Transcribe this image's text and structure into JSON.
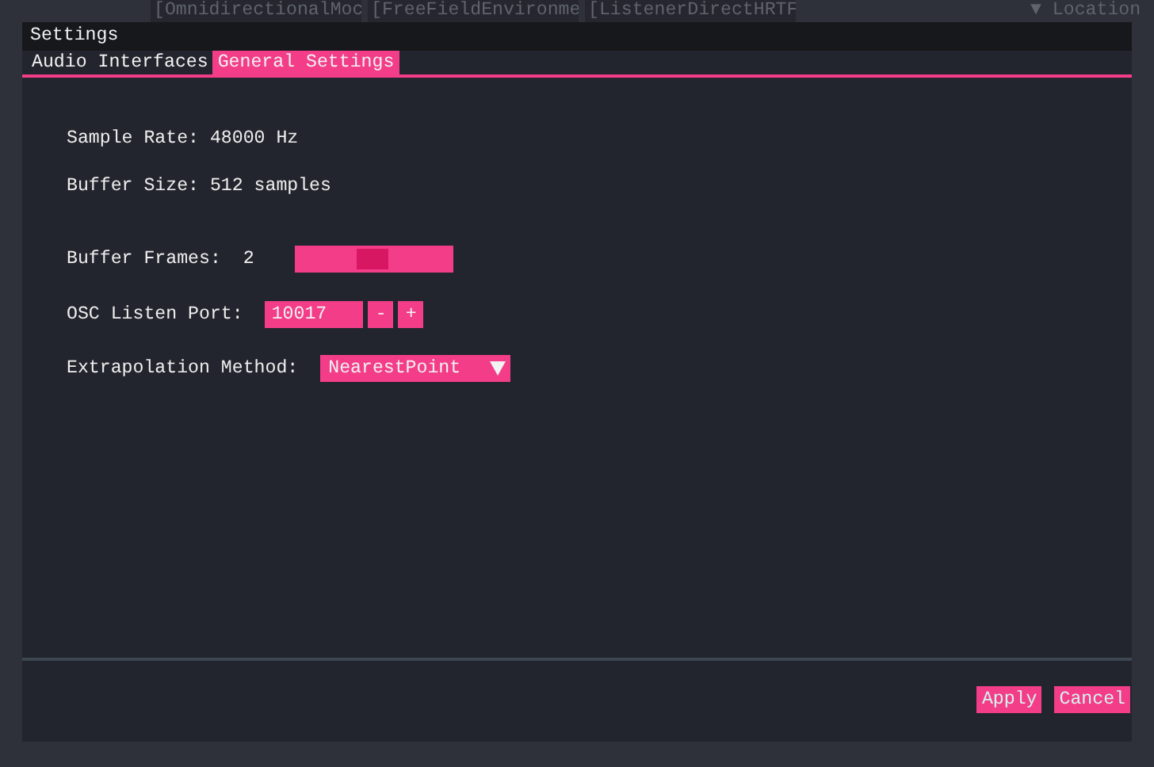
{
  "background": {
    "panels": [
      "[OmnidirectionalMoc",
      "[FreeFieldEnvironme",
      "[ListenerDirectHRTF"
    ],
    "tree_header": "▼ Location"
  },
  "dialog": {
    "title": "Settings",
    "tabs": [
      {
        "label": "Audio Interfaces",
        "selected": false
      },
      {
        "label": "General Settings",
        "selected": true
      }
    ],
    "info": [
      "Sample Rate: 48000 Hz",
      "Buffer Size: 512 samples"
    ],
    "buffer_frames": {
      "label": "Buffer Frames:",
      "value": "2",
      "level": 0.5
    },
    "osc_port": {
      "label": "OSC Listen Port:",
      "value": "10017",
      "decrement": "-",
      "increment": "+"
    },
    "extrapolation": {
      "label": "Extrapolation Method:",
      "value": "NearestPoint"
    },
    "buttons": [
      "Apply",
      "Cancel"
    ]
  }
}
